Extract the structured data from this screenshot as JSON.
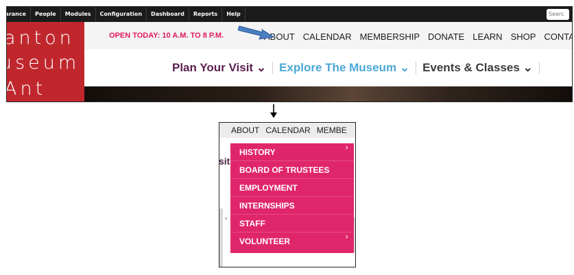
{
  "admin_bar": {
    "items": [
      "earance",
      "People",
      "Modules",
      "Configuration",
      "Dashboard",
      "Reports",
      "Help"
    ],
    "search_placeholder": "Searc"
  },
  "logo": {
    "lines": [
      "anton",
      "ɹseum",
      "Ant"
    ]
  },
  "utility_bar": {
    "open_today": "OPEN TODAY: 10 A.M. TO 8 P.M.",
    "links": [
      "ABOUT",
      "CALENDAR",
      "MEMBERSHIP",
      "DONATE",
      "LEARN",
      "SHOP",
      "CONTAC"
    ]
  },
  "main_nav": {
    "items": [
      {
        "label": "Plan Your Visit",
        "chevron": "⌄",
        "color": "#5b1f4e"
      },
      {
        "label": "Explore The Museum",
        "chevron": "⌄",
        "color": "#4aa8d6"
      },
      {
        "label": "Events & Classes",
        "chevron": "⌄",
        "color": "#3c3c3c"
      }
    ]
  },
  "zoom": {
    "utility_links": [
      "ABOUT",
      "CALENDAR",
      "MEMBE"
    ],
    "partial_text": "sit",
    "tick": "▾",
    "dropdown": {
      "items": [
        {
          "label": "HISTORY",
          "chevron": "›"
        },
        {
          "label": "BOARD OF TRUSTEES",
          "chevron": ""
        },
        {
          "label": "EMPLOYMENT",
          "chevron": ""
        },
        {
          "label": "INTERNSHIPS",
          "chevron": ""
        },
        {
          "label": "STAFF",
          "chevron": ""
        },
        {
          "label": "VOLUNTEER",
          "chevron": "›"
        }
      ]
    }
  },
  "colors": {
    "accent": "#e0266b",
    "brand_red": "#c0272d",
    "open_today": "#e0185f",
    "pointer_arrow": "#4a7fc1"
  }
}
